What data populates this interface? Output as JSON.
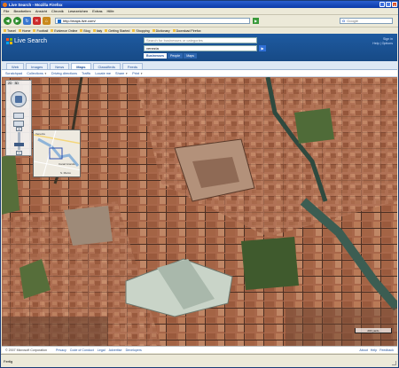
{
  "window": {
    "title": "Live Search - Mozilla Firefox",
    "controls": [
      "_",
      "□",
      "x"
    ]
  },
  "menu": [
    "File",
    "Bearbeiten",
    "Ansicht",
    "Chronik",
    "Lesezeichen",
    "Extras",
    "Hilfe"
  ],
  "nav": {
    "url": "http://maps.live.com/",
    "search_placeholder": "Google",
    "search_engine_label": "G"
  },
  "bookmarks": [
    "Travel",
    "Home",
    "Football",
    "Evidence Online",
    "Blog",
    "Italy",
    "Getting Started",
    "Shopping",
    "Dictionary",
    "Download Firefox"
  ],
  "header": {
    "logo": "Live Search",
    "search_placeholder": "Search for businesses or categories",
    "where_value": "venezia",
    "go_label": "▶",
    "subtabs": [
      "Businesses",
      "People",
      "Maps"
    ],
    "signin": "Sign in",
    "help": "Help",
    "links": "Options"
  },
  "tabs": [
    "Web",
    "Images",
    "News",
    "Maps",
    "Classifieds",
    "Feeds"
  ],
  "toolbar": [
    "Scratchpad",
    "Collections",
    "Driving directions",
    "Traffic",
    "Locate me",
    "Share",
    "Print"
  ],
  "nav3d": {
    "modes": [
      "2D",
      "3D"
    ],
    "plus": "+",
    "minus": "−"
  },
  "minimap_labels": [
    "Venezia",
    "Canal Grande",
    "S. Marco"
  ],
  "scale": "200 yards",
  "footer": {
    "copyright": "© 2007 Microsoft Corporation",
    "links": [
      "Privacy",
      "Code of Conduct",
      "Legal",
      "Advertise",
      "Developers"
    ],
    "right": [
      "About",
      "Help",
      "Feedback"
    ]
  },
  "status": "Fertig",
  "colors": {
    "header_blue": "#1e5aa0",
    "link_blue": "#1d4f9c",
    "titlebar": "#0b3aa8"
  }
}
